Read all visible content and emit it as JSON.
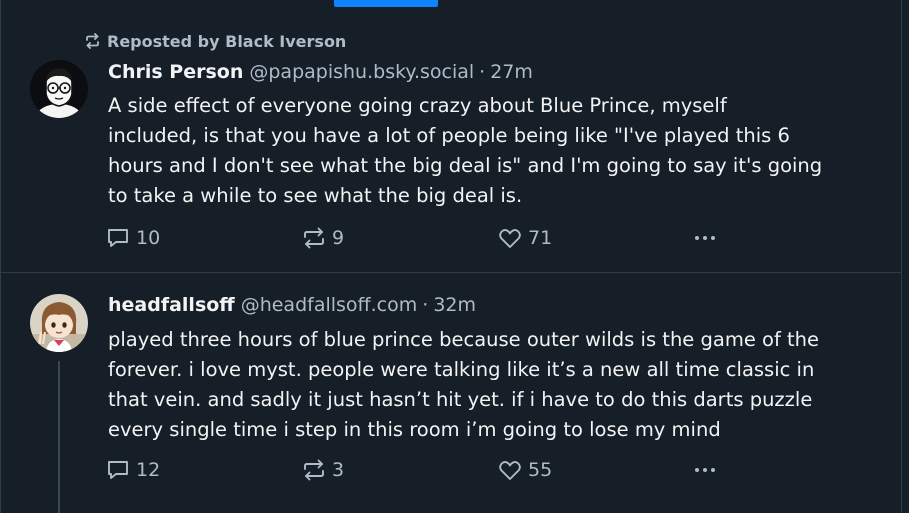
{
  "colors": {
    "background": "#161e27",
    "accent": "#1083fe",
    "text_primary": "#f1f3f5",
    "text_secondary": "#aebbc9",
    "border": "#2e3b49"
  },
  "feed": {
    "posts": [
      {
        "repost_label": "Reposted by Black Iverson",
        "repost_icon": "repost-icon",
        "avatar": "avatar-glasses-man",
        "display_name": "Chris Person",
        "handle": "@papapishu.bsky.social",
        "separator": "·",
        "time": "27m",
        "text_lines": [
          "A side effect of everyone going crazy about Blue Prince, myself",
          "included, is that you have a lot of people being like \"I've played this 6",
          "hours and I don't see what the big deal is\" and I'm going to say it's going",
          "to take a while to see what the big deal is."
        ],
        "replies": "10",
        "reposts": "9",
        "likes": "71"
      },
      {
        "avatar": "avatar-anime-girl",
        "display_name": "headfallsoff",
        "handle": "@headfallsoff.com",
        "separator": "·",
        "time": "32m",
        "text_lines": [
          "played three hours of blue prince because outer wilds is the game of the",
          "forever. i love myst. people were talking like it’s a new all time classic in",
          "that vein. and sadly it just hasn’t hit yet. if i have to do this darts puzzle",
          "every single time i step in this room i’m going to lose my mind"
        ],
        "replies": "12",
        "reposts": "3",
        "likes": "55"
      }
    ]
  }
}
